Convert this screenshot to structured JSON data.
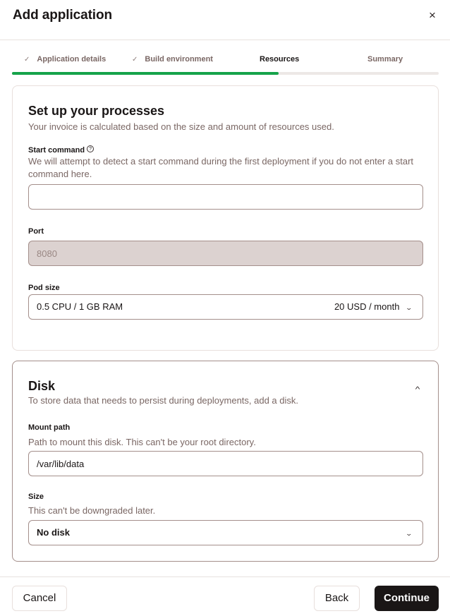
{
  "dialog": {
    "title": "Add application",
    "close_icon": "×"
  },
  "steps": [
    {
      "label": "Application details",
      "state": "complete",
      "icon": "✓"
    },
    {
      "label": "Build environment",
      "state": "complete",
      "icon": "✓"
    },
    {
      "label": "Resources",
      "state": "active"
    },
    {
      "label": "Summary",
      "state": "upcoming"
    }
  ],
  "progress": {
    "percent": 62.5,
    "color": "#16a34a"
  },
  "processes": {
    "title": "Set up your processes",
    "subtitle": "Your invoice is calculated based on the size and amount of resources used.",
    "start_command": {
      "label": "Start command",
      "help_icon": "?",
      "help": "We will attempt to detect a start command during the first deployment if you do not enter a start command here.",
      "value": ""
    },
    "port": {
      "label": "Port",
      "value": "8080"
    },
    "pod_size": {
      "label": "Pod size",
      "value": "0.5 CPU / 1 GB RAM",
      "price": "20 USD / month",
      "chevron": "⌄"
    }
  },
  "disk": {
    "title": "Disk",
    "subtitle": "To store data that needs to persist during deployments, add a disk.",
    "collapse_icon": "^",
    "mount_path": {
      "label": "Mount path",
      "help": "Path to mount this disk. This can't be your root directory.",
      "value": "/var/lib/data"
    },
    "size": {
      "label": "Size",
      "help": "This can't be downgraded later.",
      "value": "No disk",
      "chevron": "⌄"
    }
  },
  "footer": {
    "cancel": "Cancel",
    "back": "Back",
    "continue": "Continue"
  }
}
